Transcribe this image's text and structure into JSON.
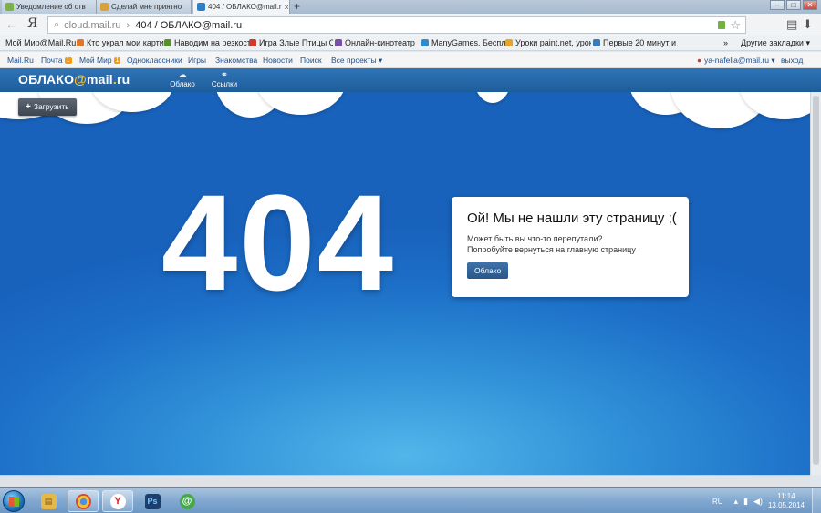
{
  "browser": {
    "tabs": [
      {
        "title": "Уведомление об отв",
        "active": false,
        "icon_color": "#7bb04a"
      },
      {
        "title": "Сделай мне приятно",
        "active": false,
        "icon_color": "#d7a23a"
      },
      {
        "title": "404 / ОБЛАКО@mail.r",
        "active": true,
        "icon_color": "#2f7ec4"
      }
    ],
    "new_tab": "+",
    "window_buttons": {
      "minimize": "–",
      "maximize": "□",
      "close": "✕"
    },
    "address": {
      "domain": "cloud.mail.ru",
      "separator": "›",
      "page_title": "404 / ОБЛАКО@mail.ru"
    },
    "yandex_button": "Я"
  },
  "bookmarks": {
    "items": [
      {
        "label": "Мой Мир@Mail.Ru",
        "icon_color": "#1e6bc1"
      },
      {
        "label": "Кто украл мои карти",
        "icon_color": "#e0762d"
      },
      {
        "label": "Наводим на резкост",
        "icon_color": "#5a8f2e"
      },
      {
        "label": "Игра Злые Птицы С",
        "icon_color": "#cc3b2f"
      },
      {
        "label": "Онлайн-кинотеатр",
        "icon_color": "#7a4fa3"
      },
      {
        "label": "ManyGames. Бесплат",
        "icon_color": "#2f8ccc"
      },
      {
        "label": "Уроки paint.net, урок",
        "icon_color": "#e5a52b"
      },
      {
        "label": "Первые 20 минут и",
        "icon_color": "#3a79b8"
      }
    ],
    "overflow": "»",
    "other": "Другие закладки ▾"
  },
  "portal": {
    "links": [
      {
        "label": "Mail.Ru"
      },
      {
        "label": "Почта",
        "badge": "1"
      },
      {
        "label": "Мой Мир",
        "badge": "1"
      },
      {
        "label": "Одноклассники"
      },
      {
        "label": "Игры"
      },
      {
        "label": "Знакомства"
      },
      {
        "label": "Новости"
      },
      {
        "label": "Поиск"
      },
      {
        "label": "Все проекты ▾"
      }
    ],
    "user": "ya-nafella@mail.ru ▾",
    "logout": "выход"
  },
  "cloud": {
    "logo_text": "ОБЛАКО",
    "logo_at": "@",
    "logo_mail": "mail",
    "logo_dot": ".",
    "logo_ru": "ru",
    "nav": [
      {
        "label": "Облако",
        "icon": "cloud-icon"
      },
      {
        "label": "Ссылки",
        "icon": "link-icon"
      }
    ],
    "upload_label": "Загрузить"
  },
  "error": {
    "code": "404",
    "heading": "Ой! Мы не нашли эту страницу ;(",
    "line1": "Может быть вы что-то перепутали?",
    "line2": "Попробуйте вернуться на главную страницу",
    "button": "Облако"
  },
  "taskbar": {
    "apps": [
      {
        "name": "explorer",
        "color": "#e6b84a",
        "glyph": "▤"
      },
      {
        "name": "chrome",
        "color": "#3b8e3f",
        "glyph": "◉"
      },
      {
        "name": "yandex",
        "color": "#d9262b",
        "glyph": "Y"
      },
      {
        "name": "photoshop",
        "color": "#1c3f6e",
        "glyph": "Ps"
      },
      {
        "name": "mail-agent",
        "color": "#46a84a",
        "glyph": "@"
      }
    ],
    "lang": "RU",
    "time": "11:14",
    "date": "13.05.2014"
  }
}
